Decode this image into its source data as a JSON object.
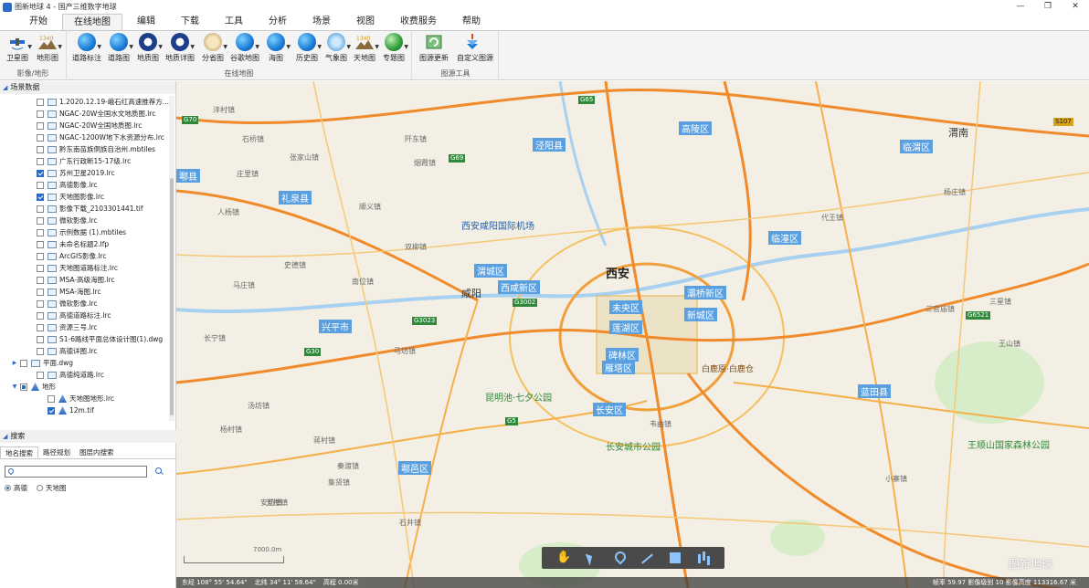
{
  "window": {
    "title": "图新地球 4 - 国产三维数字地球",
    "controls": [
      "—",
      "❐",
      "✕"
    ]
  },
  "menu": {
    "tabs": [
      "开始",
      "在线地图",
      "编辑",
      "下载",
      "工具",
      "分析",
      "场景",
      "视图",
      "收费服务",
      "帮助"
    ],
    "active": "在线地图"
  },
  "ribbon": {
    "groups": [
      {
        "title": "影像/地形",
        "buttons": [
          "卫星图",
          "地形图"
        ]
      },
      {
        "title": "在线地图",
        "buttons": [
          "道路标注",
          "道路图",
          "地质图",
          "地质详图",
          "分省图",
          "谷歌地图",
          "海图",
          "历史图",
          "气象图",
          "天地图",
          "专题图"
        ]
      },
      {
        "title": "图源工具",
        "buttons": [
          "图源更新",
          "自定义图源"
        ]
      }
    ]
  },
  "left_panel": {
    "scene_header": "场景数据",
    "layers": [
      {
        "label": "1.2020.12.19-峨石红高速推荐方...",
        "checked": false,
        "type": "file"
      },
      {
        "label": "NGAC-20W全国水文地质图.lrc",
        "checked": false,
        "type": "file"
      },
      {
        "label": "NGAC-20W全国地质图.lrc",
        "checked": false,
        "type": "file"
      },
      {
        "label": "NGAC-1200W地下水资源分布.lrc",
        "checked": false,
        "type": "file"
      },
      {
        "label": "黔东南苗族侗族自治州.mbtiles",
        "checked": false,
        "type": "file"
      },
      {
        "label": "广东行政断15-17级.lrc",
        "checked": false,
        "type": "file"
      },
      {
        "label": "苏州卫星2019.lrc",
        "checked": true,
        "type": "file"
      },
      {
        "label": "高德影像.lrc",
        "checked": false,
        "type": "file"
      },
      {
        "label": "天地图影像.lrc",
        "checked": true,
        "type": "file"
      },
      {
        "label": "影像下载_2103301441.tif",
        "checked": false,
        "type": "file"
      },
      {
        "label": "微软影像.lrc",
        "checked": false,
        "type": "file"
      },
      {
        "label": "示例数据 (1).mbtiles",
        "checked": false,
        "type": "file"
      },
      {
        "label": "未命名标题2.lfp",
        "checked": false,
        "type": "file"
      },
      {
        "label": "ArcGIS影像.lrc",
        "checked": false,
        "type": "file"
      },
      {
        "label": "天地图道路标注.lrc",
        "checked": false,
        "type": "file"
      },
      {
        "label": "MSA-高级海图.lrc",
        "checked": false,
        "type": "file"
      },
      {
        "label": "MSA-海图.lrc",
        "checked": false,
        "type": "file"
      },
      {
        "label": "微软影像.lrc",
        "checked": false,
        "type": "file"
      },
      {
        "label": "高德道路标注.lrc",
        "checked": false,
        "type": "file"
      },
      {
        "label": "资源三号.lrc",
        "checked": false,
        "type": "file"
      },
      {
        "label": "S1-6路线平面总体设计图(1).dwg",
        "checked": false,
        "type": "file"
      },
      {
        "label": "高德详图.lrc",
        "checked": false,
        "type": "file"
      },
      {
        "label": "平面.dwg",
        "checked": false,
        "type": "file",
        "expander": true
      },
      {
        "label": "高德纯道路.lrc",
        "checked": false,
        "type": "file"
      },
      {
        "label": "地形",
        "checked": "partial",
        "type": "folder",
        "expander": "open"
      },
      {
        "label": "天地图地形.lrc",
        "checked": false,
        "type": "layer",
        "indent": 1
      },
      {
        "label": "12m.tif",
        "checked": true,
        "type": "layer",
        "indent": 1
      }
    ],
    "search_header": "搜索",
    "search_tabs": [
      "地名搜索",
      "路径规划",
      "图层内搜索"
    ],
    "search_value": "",
    "radio_options": [
      {
        "label": "高德",
        "selected": true
      },
      {
        "label": "天地图",
        "selected": false
      }
    ]
  },
  "map": {
    "big_city": "西安",
    "cities": [
      "咸阳",
      "渭南"
    ],
    "district_labels": [
      "泾阳县",
      "礼泉县",
      "渭城区",
      "西咸新区",
      "未央区",
      "莲湖区",
      "碑林区",
      "雁塔区",
      "灞桥新区",
      "新城区",
      "临潼区",
      "兴平市",
      "长安区",
      "鄠邑区",
      "蓝田县",
      "高陵区",
      "鄠县",
      "临渭区"
    ],
    "towns": [
      "沣村镇",
      "石桥镇",
      "阡东镇",
      "烟霞镇",
      "张家山镇",
      "庄里镇",
      "顺义镇",
      "人杨镇",
      "马庄镇",
      "史德镇",
      "双柳镇",
      "南位镇",
      "长宁镇",
      "马坊镇",
      "汤坊镇",
      "秦渡镇",
      "蒋村镇",
      "杨村镇",
      "五楼镇",
      "集贤镇",
      "石井镇",
      "韦曲镇",
      "三官庙镇",
      "代王镇",
      "小寨镇",
      "三星镇",
      "王山镇",
      "杨庄镇",
      "安坊镇"
    ],
    "airport": "西安咸阳国际机场",
    "parks": [
      "昆明池·七夕公园",
      "长安城市公园",
      "王顺山国家森林公园"
    ],
    "poi": "白鹿原·白鹿仓",
    "road_shields": [
      "G70",
      "G65",
      "G69",
      "G5",
      "G30",
      "G3002",
      "G3023",
      "G6521",
      "S107"
    ],
    "scale_label": "7000.0m",
    "watermark": "图新地球",
    "status": {
      "lon": "东经 108° 55' 54.64\"",
      "lat": "北纬 34° 11' 58.64\"",
      "elev": "高程 0.00米",
      "right": "帧率 59.97  影像级别 10  影像高度 113316.67 米"
    }
  },
  "map_tools": [
    "hand",
    "arrow",
    "pin",
    "line",
    "polygon",
    "measure"
  ]
}
